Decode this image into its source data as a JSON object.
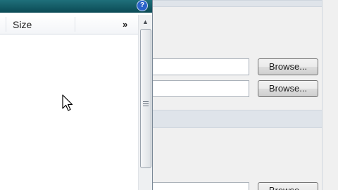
{
  "file_pane": {
    "help_glyph": "?",
    "columns": {
      "size_label": "Size",
      "more_label": "»"
    },
    "scroll_up_glyph": "▲"
  },
  "dialog": {
    "browse_label": "Browse..."
  },
  "icons": {
    "help": "help-icon",
    "cursor": "arrow-cursor-icon",
    "grip": "scroll-grip-icon"
  },
  "colors": {
    "pane_title": "#0b4a55",
    "help_badge": "#2a63c9",
    "dialog_bg": "#f0f0f0",
    "section_band": "#dfe4ea"
  }
}
